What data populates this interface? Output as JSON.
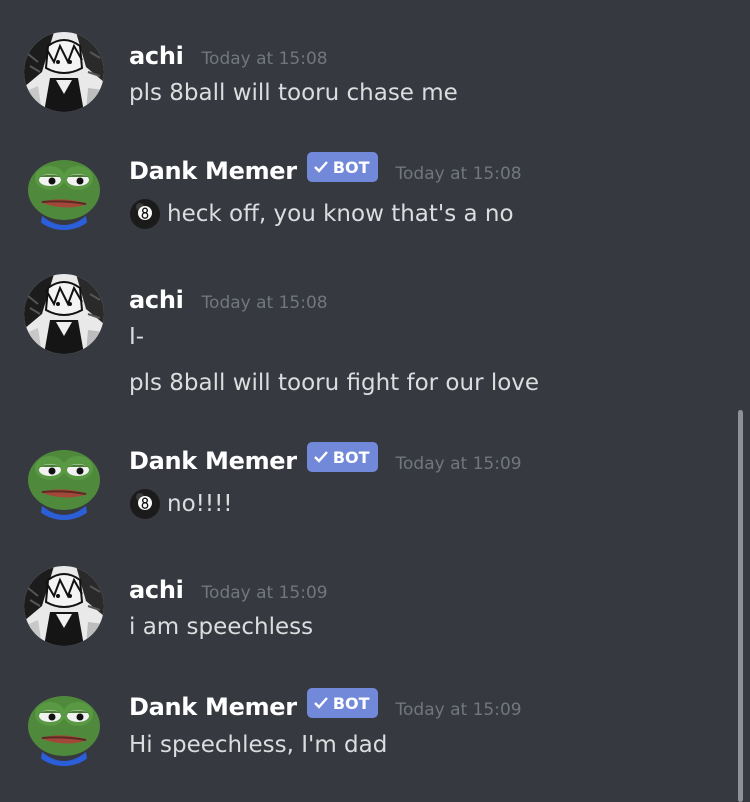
{
  "colors": {
    "background": "#36393f",
    "username": "#ffffff",
    "timestamp": "#72767d",
    "message_text": "#dcddde",
    "bot_tag": "#7289da"
  },
  "bot_tag": {
    "label": "BOT",
    "icon": "check-icon"
  },
  "messages": [
    {
      "author": "achi",
      "timestamp": "Today at 15:08",
      "avatar": "manga-avatar",
      "is_bot": false,
      "lines": [
        "pls 8ball will tooru chase me"
      ]
    },
    {
      "author": "Dank Memer",
      "timestamp": "Today at 15:08",
      "avatar": "pepe-frog-avatar",
      "is_bot": true,
      "lines": [
        "heck off, you know that's a no"
      ],
      "emoji": "8ball-icon"
    },
    {
      "author": "achi",
      "timestamp": "Today at 15:08",
      "avatar": "manga-avatar",
      "is_bot": false,
      "lines": [
        "I-",
        "pls 8ball will tooru fight for our love"
      ]
    },
    {
      "author": "Dank Memer",
      "timestamp": "Today at 15:09",
      "avatar": "pepe-frog-avatar",
      "is_bot": true,
      "lines": [
        "no!!!!"
      ],
      "emoji": "8ball-icon"
    },
    {
      "author": "achi",
      "timestamp": "Today at 15:09",
      "avatar": "manga-avatar",
      "is_bot": false,
      "lines": [
        "i am speechless"
      ]
    },
    {
      "author": "Dank Memer",
      "timestamp": "Today at 15:09",
      "avatar": "pepe-frog-avatar",
      "is_bot": true,
      "lines": [
        "Hi speechless, I'm dad"
      ]
    }
  ]
}
